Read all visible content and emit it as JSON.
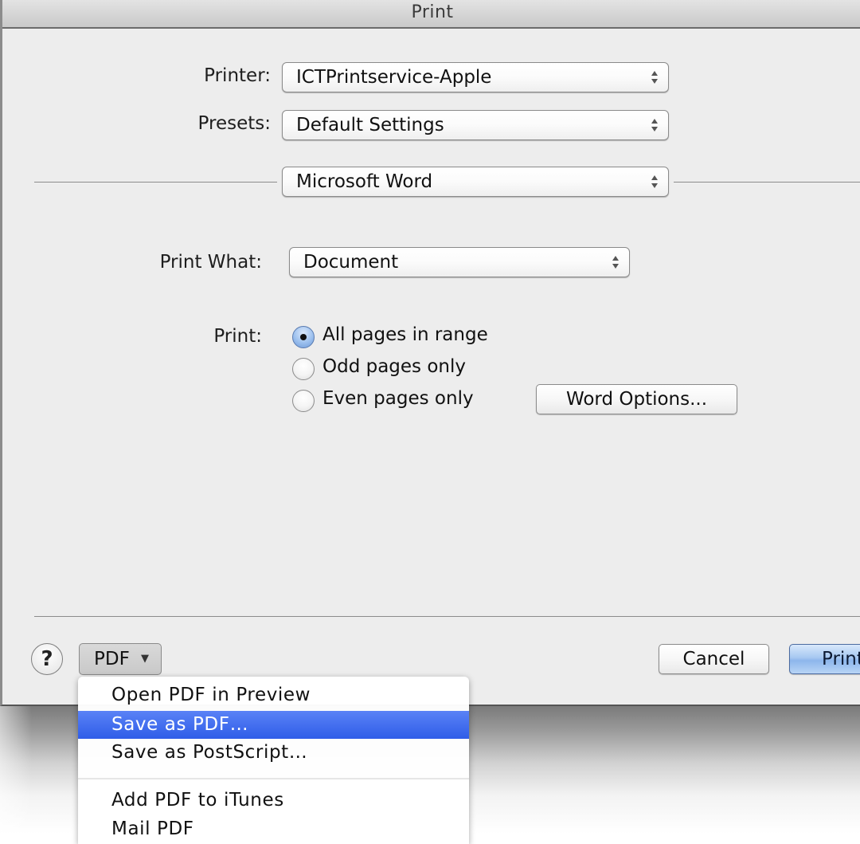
{
  "window": {
    "title": "Print"
  },
  "printer": {
    "label": "Printer:",
    "value": "ICTPrintservice-Apple"
  },
  "presets": {
    "label": "Presets:",
    "value": "Default Settings"
  },
  "pane_selector": {
    "value": "Microsoft Word"
  },
  "print_what": {
    "label": "Print What:",
    "value": "Document"
  },
  "print_range": {
    "label": "Print:",
    "options": [
      {
        "label": "All pages in range",
        "checked": true
      },
      {
        "label": "Odd pages only",
        "checked": false
      },
      {
        "label": "Even pages only",
        "checked": false
      }
    ]
  },
  "word_options_button": {
    "label": "Word Options..."
  },
  "footer": {
    "help_label": "?",
    "pdf_label": "PDF",
    "pdf_arrow": "▼",
    "cancel_label": "Cancel",
    "print_label": "Print"
  },
  "pdf_menu": {
    "items": [
      {
        "label": "Open PDF in Preview",
        "highlighted": false
      },
      {
        "label": "Save as PDF…",
        "highlighted": true
      },
      {
        "label": "Save as PostScript…",
        "highlighted": false
      },
      {
        "label": "Add PDF to iTunes",
        "highlighted": false
      },
      {
        "label": "Mail PDF",
        "highlighted": false
      }
    ]
  },
  "colors": {
    "highlight": "#2f5de8",
    "sheet_bg": "#ededed",
    "default_button": "#a7c8f1"
  }
}
